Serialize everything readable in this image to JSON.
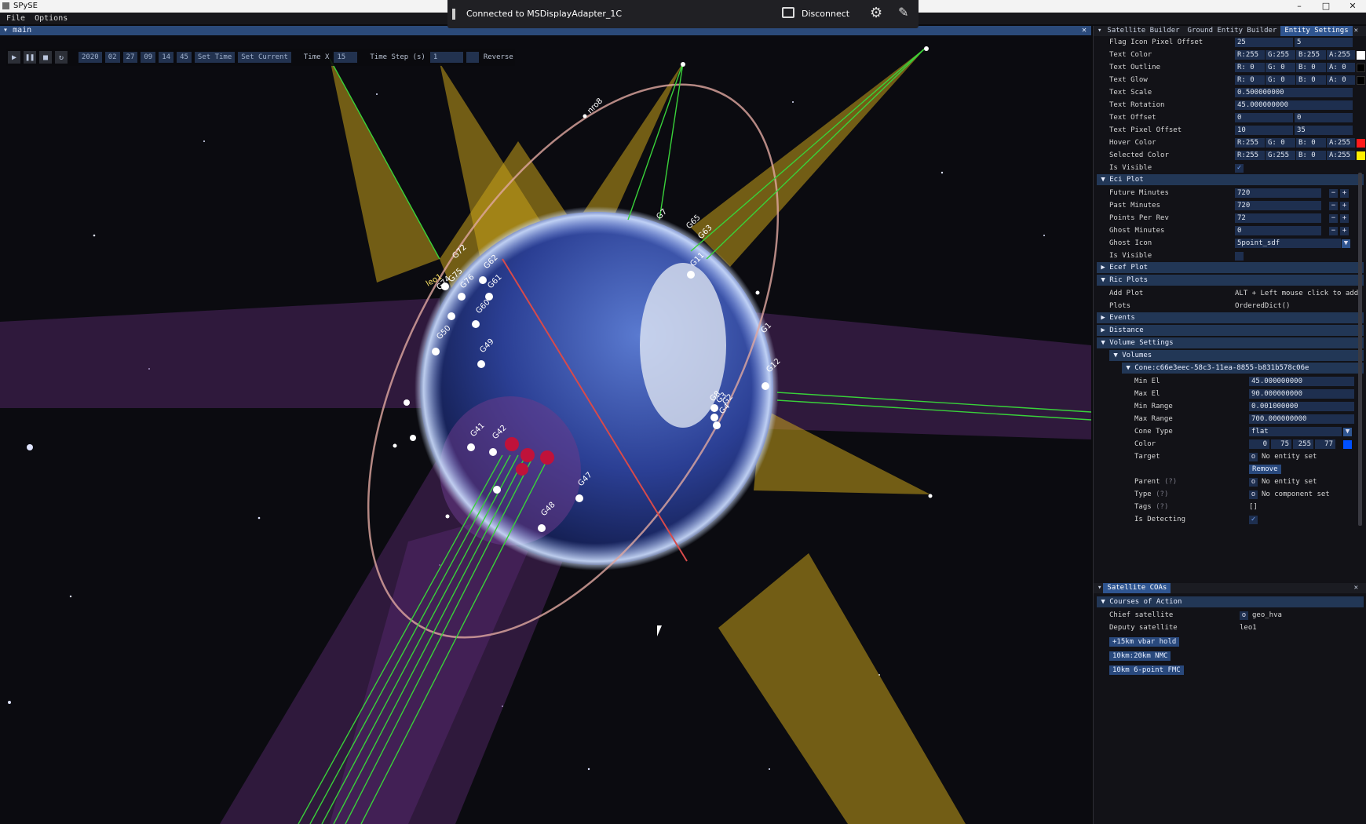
{
  "window": {
    "title": "SPySE",
    "min": "–",
    "max": "□",
    "close": "✕"
  },
  "menu": {
    "file": "File",
    "options": "Options"
  },
  "cast": {
    "status": "Connected to MSDisplayAdapter_1C",
    "disconnect": "Disconnect"
  },
  "viewport": {
    "tab": "main",
    "close": "✕"
  },
  "toolbar": {
    "date": [
      "2020",
      "02",
      "27"
    ],
    "time": [
      "09",
      "14",
      "45"
    ],
    "set_time": "Set Time",
    "set_current": "Set Current",
    "time_x_label": "Time X",
    "time_x_value": "15",
    "time_step_label": "Time Step (s)",
    "time_step_value": "1",
    "reverse": "Reverse"
  },
  "scene_labels": [
    "G72",
    "G74",
    "G75",
    "G76",
    "G61",
    "G62",
    "G60",
    "G50",
    "G49",
    "G41",
    "G42",
    "G47",
    "G48",
    "G65",
    "G63",
    "G12",
    "G1",
    "G7",
    "G11",
    "G8",
    "G3",
    "G2",
    "G4",
    "leo1",
    "nro8"
  ],
  "tabs": {
    "satellite_builder": "Satellite Builder",
    "ground_entity_builder": "Ground Entity Builder",
    "entity_settings": "Entity Settings",
    "close": "✕"
  },
  "entity": {
    "flag_icon_pixel_offset": {
      "label": "Flag Icon Pixel Offset",
      "a": "25",
      "b": "5"
    },
    "text_color": {
      "label": "Text Color",
      "r": "R:255",
      "g": "G:255",
      "b": "B:255",
      "a": "A:255",
      "swatch": "#ffffff"
    },
    "text_outline": {
      "label": "Text Outline",
      "r": "R:  0",
      "g": "G:  0",
      "b": "B:  0",
      "a": "A:  0",
      "swatch": "#000000"
    },
    "text_glow": {
      "label": "Text Glow",
      "r": "R:  0",
      "g": "G:  0",
      "b": "B:  0",
      "a": "A:  0",
      "swatch": "#000000"
    },
    "text_scale": {
      "label": "Text Scale",
      "value": "0.500000000"
    },
    "text_rotation": {
      "label": "Text Rotation",
      "value": "45.000000000"
    },
    "text_offset": {
      "label": "Text Offset",
      "a": "0",
      "b": "0"
    },
    "text_pixel_offset": {
      "label": "Text Pixel Offset",
      "a": "10",
      "b": "35"
    },
    "hover_color": {
      "label": "Hover Color",
      "r": "R:255",
      "g": "G:  0",
      "b": "B:  0",
      "a": "A:255",
      "swatch": "#ff1a1a"
    },
    "selected_color": {
      "label": "Selected Color",
      "r": "R:255",
      "g": "G:255",
      "b": "B:  0",
      "a": "A:255",
      "swatch": "#ffee00"
    },
    "is_visible": {
      "label": "Is Visible",
      "checked": "✓"
    }
  },
  "eci": {
    "title": "Eci Plot",
    "future_minutes": {
      "label": "Future Minutes",
      "value": "720"
    },
    "past_minutes": {
      "label": "Past Minutes",
      "value": "720"
    },
    "points_per_rev": {
      "label": "Points Per Rev",
      "value": "72"
    },
    "ghost_minutes": {
      "label": "Ghost Minutes",
      "value": "0"
    },
    "ghost_icon": {
      "label": "Ghost Icon",
      "value": "5point_sdf"
    },
    "is_visible": {
      "label": "Is Visible",
      "checked": ""
    },
    "minus": "−",
    "plus": "+"
  },
  "ecef": {
    "title": "Ecef Plot"
  },
  "ric": {
    "title": "Ric Plots",
    "add_plot": {
      "label": "Add Plot",
      "value": "ALT + Left mouse click to add"
    },
    "plots": {
      "label": "Plots",
      "value": "OrderedDict()"
    }
  },
  "events": {
    "title": "Events"
  },
  "distance": {
    "title": "Distance"
  },
  "volume": {
    "title": "Volume Settings",
    "volumes": "Volumes",
    "cone_id": "Cone:c66e3eec-58c3-11ea-8855-b831b578c06e",
    "min_el": {
      "label": "Min El",
      "value": "45.000000000"
    },
    "max_el": {
      "label": "Max El",
      "value": "90.000000000"
    },
    "min_range": {
      "label": "Min Range",
      "value": "0.001000000"
    },
    "max_range": {
      "label": "Max Range",
      "value": "700.000000000"
    },
    "cone_type": {
      "label": "Cone Type",
      "value": "flat"
    },
    "color": {
      "label": "Color",
      "r": "0",
      "g": "75",
      "b": "255",
      "a": "77",
      "swatch": "#0050ff"
    },
    "target": {
      "label": "Target",
      "btn": "o",
      "value": "No entity set"
    },
    "remove": "Remove",
    "parent": {
      "label": "Parent",
      "hint": "(?)",
      "btn": "o",
      "value": "No entity set"
    },
    "type": {
      "label": "Type",
      "hint": "(?)",
      "btn": "o",
      "value": "No component set"
    },
    "tags": {
      "label": "Tags",
      "hint": "(?)",
      "value": "[]"
    },
    "is_detecting": {
      "label": "Is Detecting",
      "checked": "✓"
    }
  },
  "coas": {
    "tab": "Satellite COAs",
    "close": "✕",
    "section": "Courses of Action",
    "chief": {
      "label": "Chief satellite",
      "btn": "o",
      "value": "geo_hva"
    },
    "deputy": {
      "label": "Deputy satellite",
      "value": "leo1"
    },
    "buttons": [
      "+15km vbar hold",
      "10km:20km NMC",
      "10km 6-point FMC"
    ]
  },
  "colors": {
    "accent": "#2f5590",
    "section": "#223756",
    "field": "#1e2f4f",
    "cone_yellow": "#c9a21a",
    "band_purple": "#5a2a73",
    "link_green": "#39d23a",
    "earth_blue": "#2f4aa6"
  }
}
